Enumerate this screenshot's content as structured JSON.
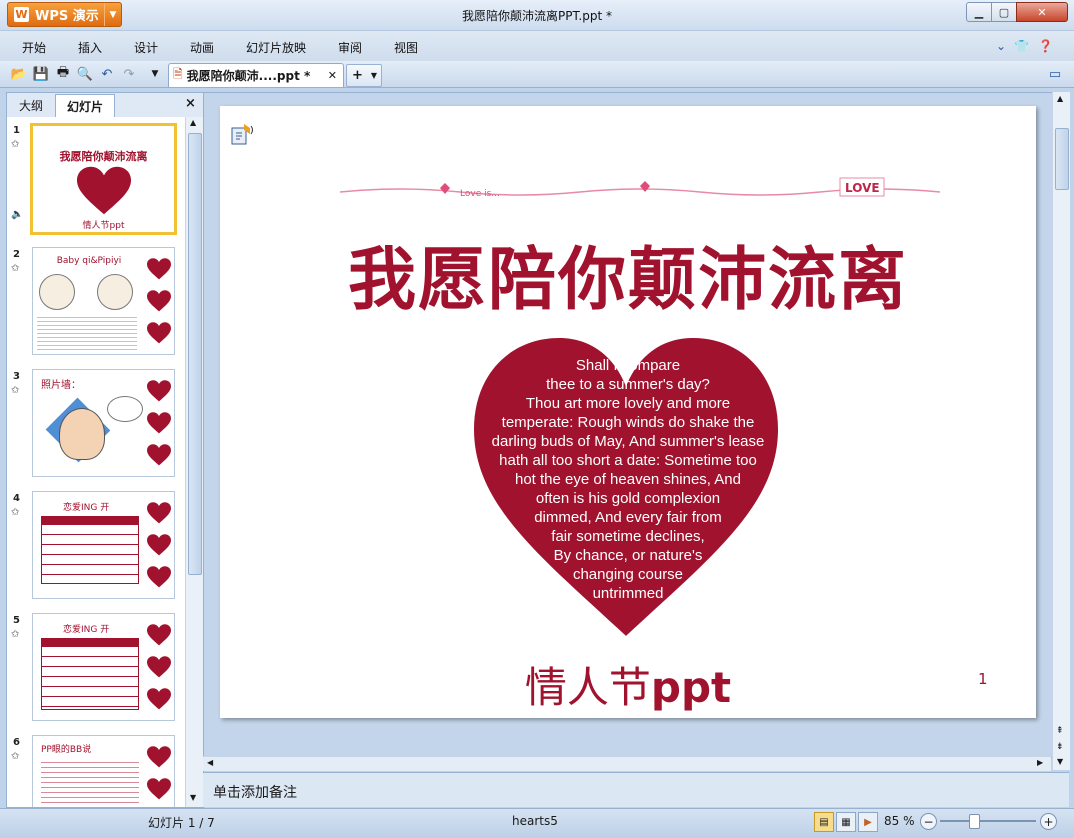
{
  "app": {
    "menu_label": "WPS 演示",
    "window_title": "我愿陪你颠沛流离PPT.ppt *"
  },
  "menu": [
    "开始",
    "插入",
    "设计",
    "动画",
    "幻灯片放映",
    "审阅",
    "视图"
  ],
  "toolbar": {
    "doc_tab_label": "我愿陪你颠沛....ppt *",
    "new_tab_label": "+"
  },
  "left_panel": {
    "tab_outline": "大纲",
    "tab_slides": "幻灯片",
    "close": "×",
    "thumbnails": [
      {
        "number": "1",
        "title": "我愿陪你颠沛流离",
        "caption": "情人节ppt"
      },
      {
        "number": "2",
        "title": "Baby qi&Pipiyi"
      },
      {
        "number": "3",
        "title": "照片墙："
      },
      {
        "number": "4",
        "title": "恋爱ING 开"
      },
      {
        "number": "5",
        "title": "恋爱ING 开"
      },
      {
        "number": "6",
        "title": "PP眼的BB说"
      }
    ]
  },
  "slide": {
    "title": "我愿陪你颠沛流离",
    "poem_lines": [
      "Shall I                    compare",
      "thee to a                    summer's day?",
      "Thou art more lovely and more",
      "temperate: Rough winds do shake the",
      "darling buds of May, And summer's lease",
      "hath all too short a date: Sometime too",
      "hot the eye of heaven  shines, And",
      "often is his gold complexion",
      "dimmed, And every fair from",
      "fair sometime declines,",
      "By chance, or nature's",
      "changing course",
      "untrimmed"
    ],
    "decor_love_is": "Love is...",
    "decor_love": "LOVE",
    "subtitle_cn": "情人节",
    "subtitle_en": "ppt",
    "page_number": "1"
  },
  "notes": {
    "placeholder": "单击添加备注"
  },
  "status": {
    "slide_indicator": "幻灯片 1 / 7",
    "theme": "hearts5",
    "zoom": "85 %",
    "zoom_fraction": 0.36
  },
  "colors": {
    "accent": "#a0122d",
    "wps_orange": "#e06b10",
    "selection": "#f2c233"
  }
}
